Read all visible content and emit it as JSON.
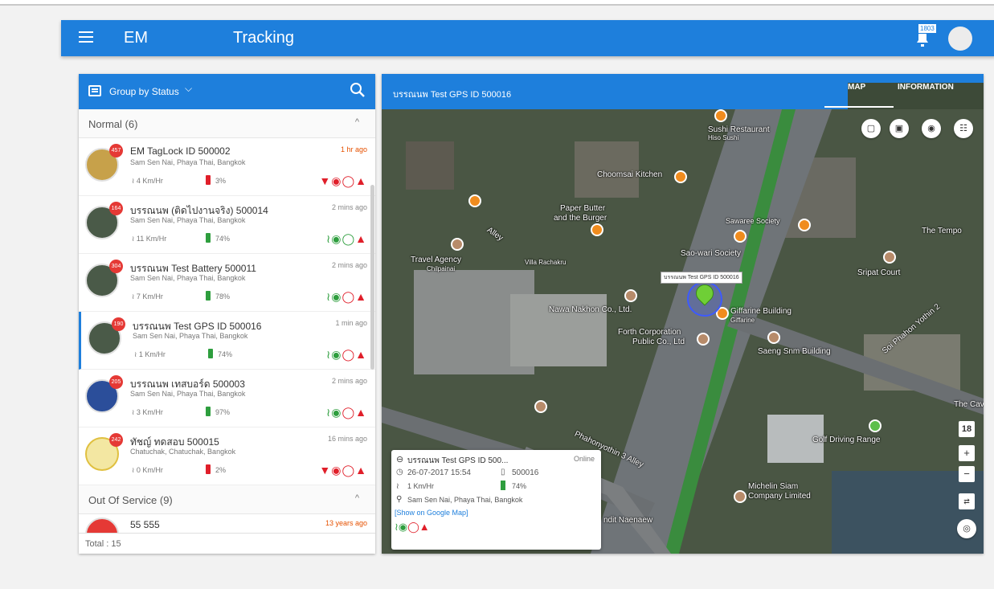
{
  "app": {
    "brand": "EM",
    "title": "Tracking",
    "notification_count": "1803"
  },
  "left_panel": {
    "group_by_label": "Group by Status",
    "sections": [
      {
        "label": "Normal (6)"
      },
      {
        "label": "Out Of Service (9)"
      }
    ],
    "items": [
      {
        "name": "EM TagLock ID 500002",
        "address": "Sam Sen Nai, Phaya Thai, Bangkok",
        "time": "1 hr ago",
        "speed": "4 Km/Hr",
        "battery": "3%",
        "badge": "457"
      },
      {
        "name": "บรรณนพ (ติดไปงานจริง) 500014",
        "address": "Sam Sen Nai, Phaya Thai, Bangkok",
        "time": "2 mins ago",
        "speed": "11 Km/Hr",
        "battery": "74%",
        "badge": "164"
      },
      {
        "name": "บรรณนพ Test Battery 500011",
        "address": "Sam Sen Nai, Phaya Thai, Bangkok",
        "time": "2 mins ago",
        "speed": "7 Km/Hr",
        "battery": "78%",
        "badge": "304"
      },
      {
        "name": "บรรณนพ Test GPS ID 500016",
        "address": "Sam Sen Nai, Phaya Thai, Bangkok",
        "time": "1 min ago",
        "speed": "1 Km/Hr",
        "battery": "74%",
        "badge": "190"
      },
      {
        "name": "บรรณนพ เทสบอร์ด 500003",
        "address": "Sam Sen Nai, Phaya Thai, Bangkok",
        "time": "2 mins ago",
        "speed": "3 Km/Hr",
        "battery": "97%",
        "badge": "205"
      },
      {
        "name": "ทัชญ์ ทดสอบ 500015",
        "address": "Chatuchak, Chatuchak, Bangkok",
        "time": "16 mins ago",
        "speed": "0 Km/Hr",
        "battery": "2%",
        "badge": "242"
      },
      {
        "name": "55 555",
        "time": "13 years ago"
      }
    ],
    "total": "Total : 15"
  },
  "right_panel": {
    "device_title": "บรรณนพ Test GPS ID 500016",
    "tabs": {
      "map": "MAP",
      "information": "INFORMATION"
    },
    "zoom_level": "18",
    "marker_tooltip": "บรรณนพ Test GPS ID 500016",
    "popup": {
      "name": "บรรณนพ Test GPS ID 500...",
      "status": "Online",
      "datetime": "26-07-2017 15:54",
      "device_id": "500016",
      "speed": "1 Km/Hr",
      "battery": "74%",
      "address": "Sam Sen Nai, Phaya Thai, Bangkok",
      "google_link": "[Show on Google Map]"
    },
    "map_labels": {
      "sushi": "Sushi Restaurant",
      "sushi_sub": "Hiso Sushi",
      "choomsai": "Choomsai Kitchen",
      "paper_butter": "Paper Butter",
      "paper_butter_2": "and the Burger",
      "travel": "Travel Agency",
      "travel_sub": "Chilpainai",
      "sawaree": "Sawaree Society",
      "saowari": "Sao-wari Society",
      "tempo": "The Tempo",
      "sripat": "Sripat Court",
      "nawa": "Nawa Nakhon Co., Ltd.",
      "giffarine": "Giffarine Building",
      "giffarine_sub": "Giffarine",
      "forth": "Forth Corporation",
      "forth_2": "Public Co., Ltd",
      "saeng": "Saeng Snm Building",
      "golf": "Golf Driving Range",
      "michelin": "Michelin Siam",
      "michelin_2": "Company Limited",
      "phahon": "Phahonyothin 3 Alley",
      "soi_phahon": "Soi Phahon Yothin 2",
      "alley": "Alley",
      "villa": "Villa Rachakru",
      "the_cave": "The Cav",
      "naenaew": "ndit Naenaew"
    }
  },
  "colors": {
    "primary": "#1e7fdc",
    "online": "#2e9e3e",
    "alert": "#e01f2a"
  }
}
